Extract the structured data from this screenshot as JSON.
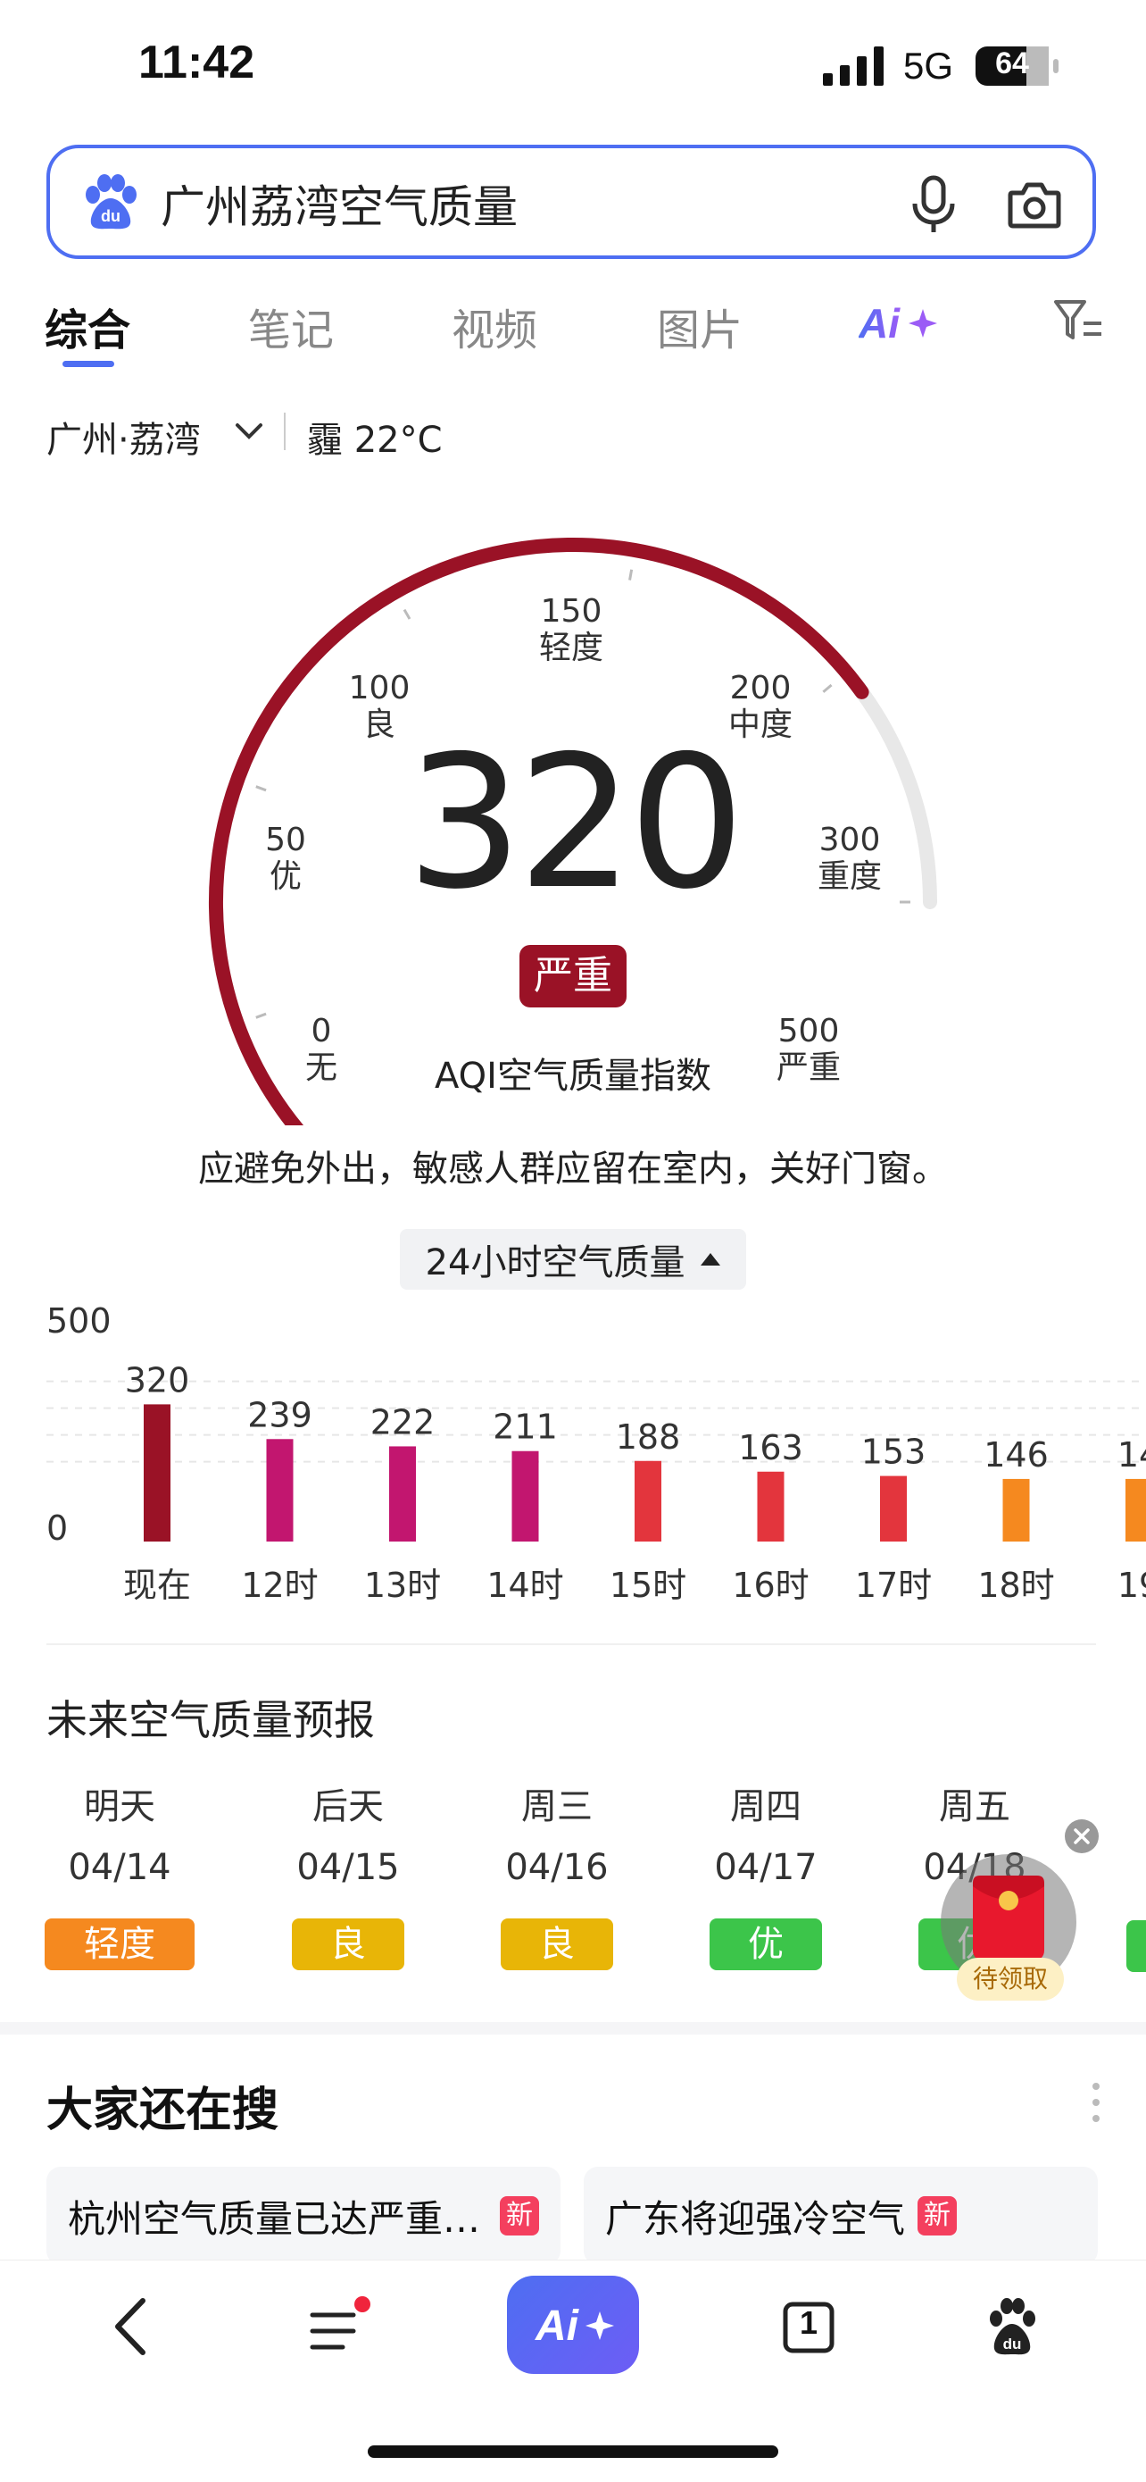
{
  "status_bar": {
    "time": "11:42",
    "network": "5G",
    "battery": "64"
  },
  "search": {
    "query": "广州荔湾空气质量"
  },
  "tabs": [
    {
      "label": "综合",
      "active": true
    },
    {
      "label": "笔记"
    },
    {
      "label": "视频"
    },
    {
      "label": "图片"
    },
    {
      "label": "Ai+",
      "icon": "ai-plus-icon"
    },
    {
      "label": "",
      "icon": "filter-icon"
    }
  ],
  "location": {
    "city": "广州·荔湾",
    "weather": "霾 22°C"
  },
  "aqi": {
    "value": "320",
    "level": "严重",
    "caption": "AQI空气质量指数",
    "scale_max": 500,
    "ticks": [
      {
        "value": "0",
        "label": "无"
      },
      {
        "value": "50",
        "label": "优"
      },
      {
        "value": "100",
        "label": "良"
      },
      {
        "value": "150",
        "label": "轻度"
      },
      {
        "value": "200",
        "label": "中度"
      },
      {
        "value": "300",
        "label": "重度"
      },
      {
        "value": "500",
        "label": "严重"
      }
    ],
    "advice": "应避免外出，敏感人群应留在室内，关好门窗。",
    "arc_color": "#9a1226"
  },
  "hourly": {
    "toggle_label": "24小时空气质量",
    "y_max_label": "500",
    "y_min_label": "0"
  },
  "chart_data": {
    "type": "bar",
    "categories": [
      "现在",
      "12时",
      "13时",
      "14时",
      "15时",
      "16时",
      "17时",
      "18时",
      "19"
    ],
    "values": [
      320,
      239,
      222,
      211,
      188,
      163,
      153,
      146,
      14
    ],
    "value_labels": [
      "320",
      "239",
      "222",
      "211",
      "188",
      "163",
      "153",
      "146",
      "14"
    ],
    "colors": [
      "#9a1226",
      "#c2166f",
      "#c2166f",
      "#c2166f",
      "#e3353d",
      "#e3353d",
      "#e3353d",
      "#f5891f",
      "#f5891f"
    ],
    "ylim": [
      0,
      500
    ]
  },
  "forecast": {
    "title": "未来空气质量预报",
    "days": [
      {
        "day": "明天",
        "date": "04/14",
        "level": "轻度",
        "color": "#f5891f"
      },
      {
        "day": "后天",
        "date": "04/15",
        "level": "良",
        "color": "#e8b507"
      },
      {
        "day": "周三",
        "date": "04/16",
        "level": "良",
        "color": "#e8b507"
      },
      {
        "day": "周四",
        "date": "04/17",
        "level": "优",
        "color": "#3cc54a"
      },
      {
        "day": "周五",
        "date": "04/18",
        "level": "优",
        "color": "#3cc54a"
      }
    ]
  },
  "red_packet": {
    "label": "待领取"
  },
  "trending": {
    "title": "大家还在搜",
    "items": [
      {
        "text": "杭州空气质量已达严重污染",
        "badge": "新"
      },
      {
        "text": "广东将迎强冷空气",
        "badge": "新"
      }
    ]
  },
  "bottom_nav": {
    "tabs_count": "1"
  }
}
